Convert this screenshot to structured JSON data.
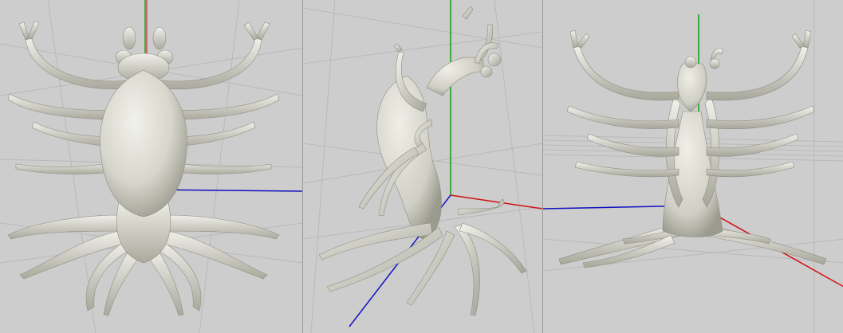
{
  "scene": {
    "background_color": "#cdcdcd",
    "model_color": "#dcdcd3",
    "model_shade_color": "#a8a89c",
    "grid_color": "#b8b8b8",
    "axis_colors": {
      "x": "#d01010",
      "y": "#10a010",
      "z": "#1010c0"
    }
  },
  "viewports": [
    {
      "id": "top",
      "icon": "octopus-model-icon"
    },
    {
      "id": "perspective",
      "icon": "octopus-model-icon"
    },
    {
      "id": "front",
      "icon": "octopus-model-icon"
    }
  ]
}
